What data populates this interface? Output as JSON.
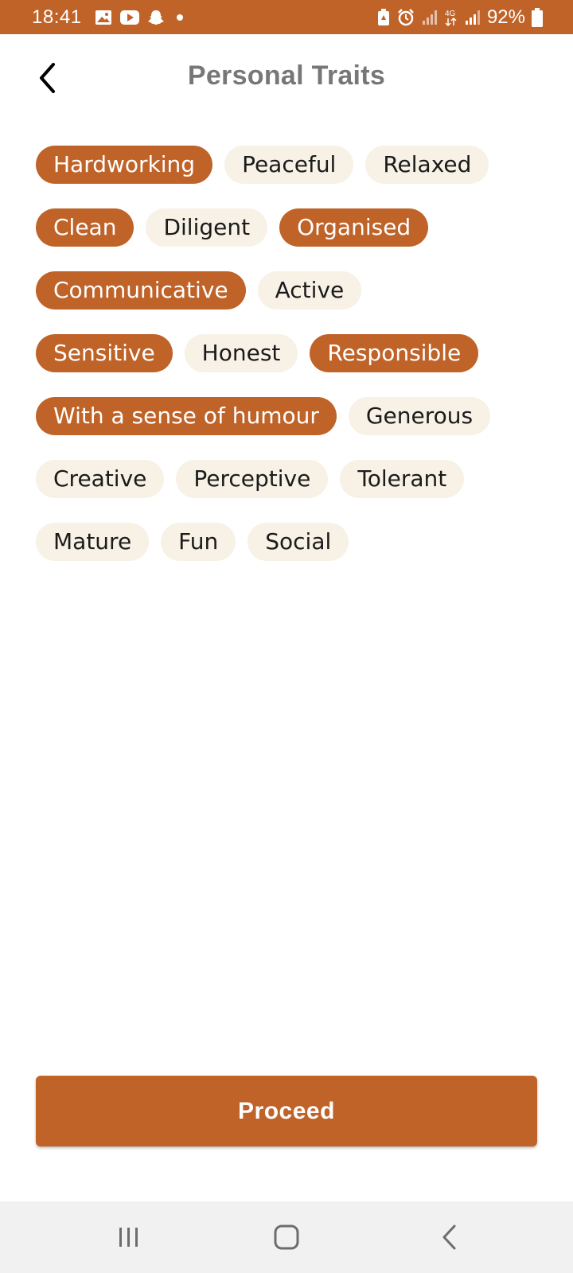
{
  "status_bar": {
    "time": "18:41",
    "battery": "92%",
    "left_icons": [
      "gallery-icon",
      "youtube-icon",
      "snapchat-icon",
      "dot-icon"
    ],
    "right_icons": [
      "battery-saver-icon",
      "alarm-icon",
      "signal-icon",
      "4g-icon",
      "signal-icon",
      "battery-icon"
    ]
  },
  "header": {
    "title": "Personal Traits",
    "back_icon": "chevron-left-icon"
  },
  "traits": {
    "rows": [
      [
        {
          "label": "Hardworking",
          "selected": true
        },
        {
          "label": "Peaceful",
          "selected": false
        },
        {
          "label": "Relaxed",
          "selected": false
        }
      ],
      [
        {
          "label": "Clean",
          "selected": true
        },
        {
          "label": "Diligent",
          "selected": false
        },
        {
          "label": "Organised",
          "selected": true
        }
      ],
      [
        {
          "label": "Communicative",
          "selected": true
        },
        {
          "label": "Active",
          "selected": false
        }
      ],
      [
        {
          "label": "Sensitive",
          "selected": true
        },
        {
          "label": "Honest",
          "selected": false
        },
        {
          "label": "Responsible",
          "selected": true
        }
      ],
      [
        {
          "label": "With a sense of humour",
          "selected": true
        },
        {
          "label": "Generous",
          "selected": false
        }
      ],
      [
        {
          "label": "Creative",
          "selected": false
        },
        {
          "label": "Perceptive",
          "selected": false
        },
        {
          "label": "Tolerant",
          "selected": false
        }
      ],
      [
        {
          "label": "Mature",
          "selected": false
        },
        {
          "label": "Fun",
          "selected": false
        },
        {
          "label": "Social",
          "selected": false
        }
      ]
    ]
  },
  "actions": {
    "proceed_label": "Proceed"
  },
  "nav_bar": {
    "buttons": [
      "recent-apps-icon",
      "home-icon",
      "back-icon"
    ]
  },
  "colors": {
    "accent": "#bf6329",
    "chip_unselected_bg": "#f7f1e6",
    "title_gray": "#777777"
  }
}
